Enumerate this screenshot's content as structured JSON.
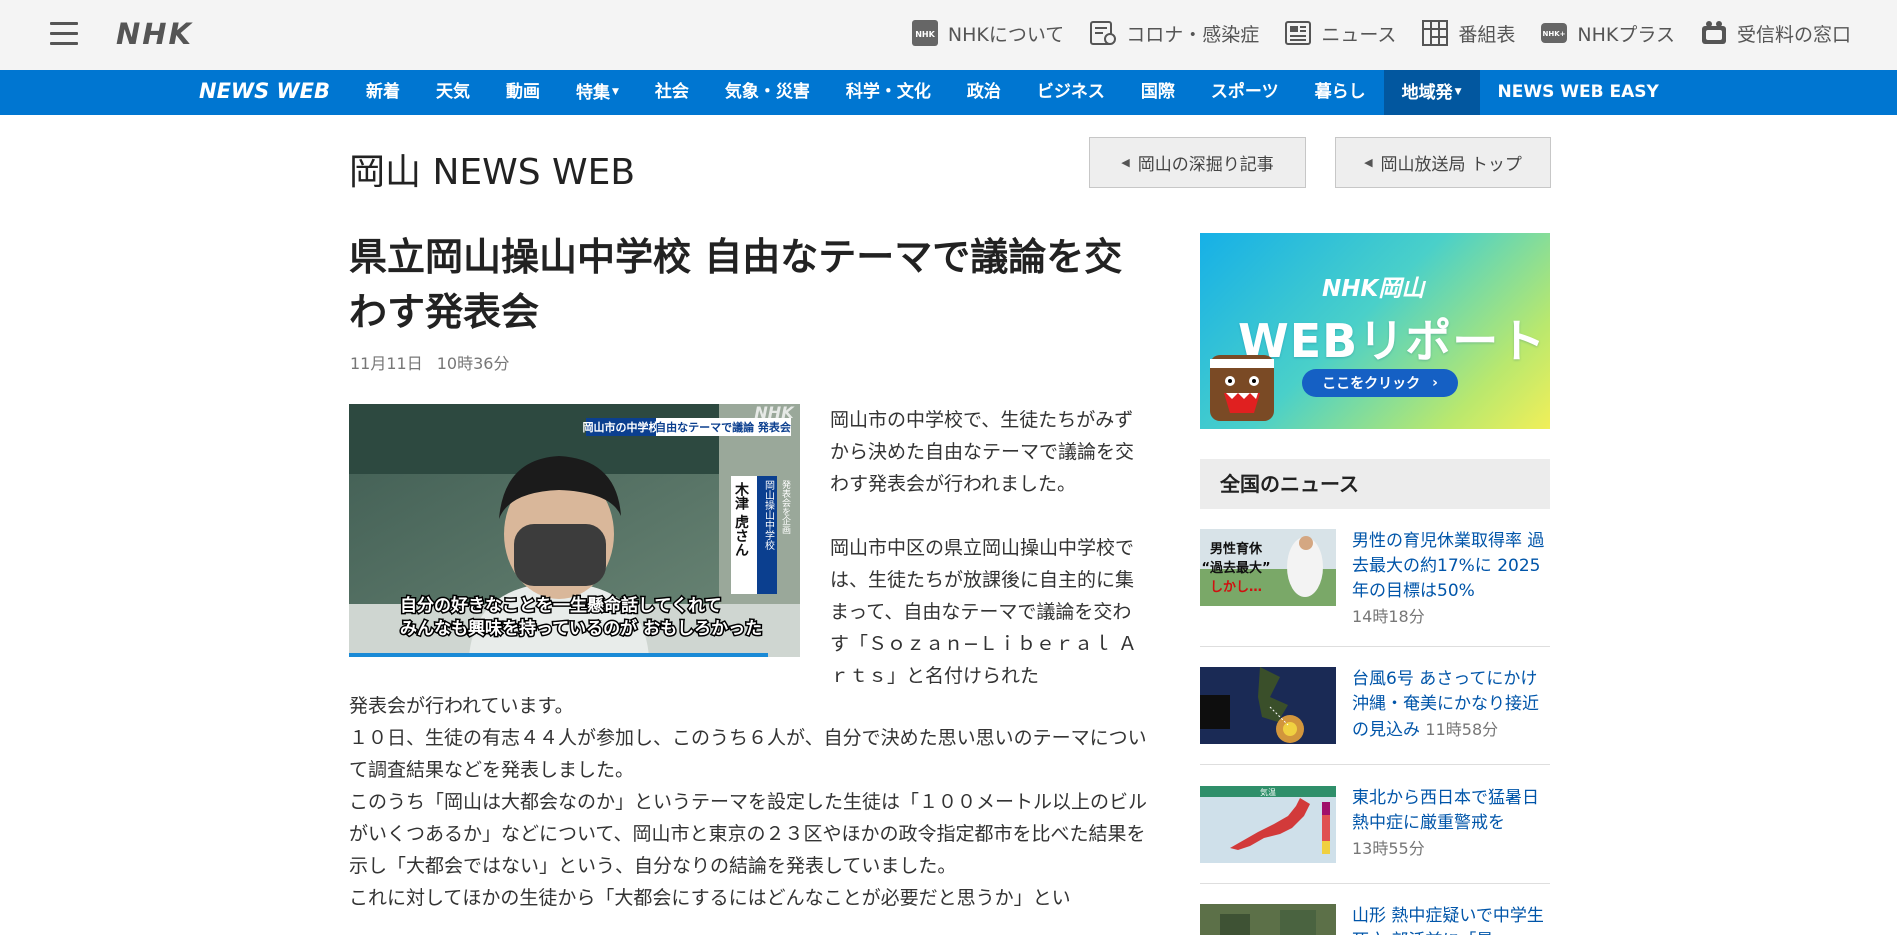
{
  "header": {
    "logo": "NHK",
    "links": [
      {
        "label": "NHKについて",
        "icon": "nhk-logo-icon"
      },
      {
        "label": "コロナ・感染症",
        "icon": "corona-info-icon"
      },
      {
        "label": "ニュース",
        "icon": "news-icon"
      },
      {
        "label": "番組表",
        "icon": "program-guide-icon"
      },
      {
        "label": "NHKプラス",
        "icon": "nhk-plus-icon"
      },
      {
        "label": "受信料の窓口",
        "icon": "reception-fee-icon"
      }
    ]
  },
  "nav": {
    "logo": "NEWS WEB",
    "items": [
      {
        "label": "新着"
      },
      {
        "label": "天気"
      },
      {
        "label": "動画"
      },
      {
        "label": "特集",
        "dropdown": true
      },
      {
        "label": "社会"
      },
      {
        "label": "気象・災害"
      },
      {
        "label": "科学・文化"
      },
      {
        "label": "政治"
      },
      {
        "label": "ビジネス"
      },
      {
        "label": "国際"
      },
      {
        "label": "スポーツ"
      },
      {
        "label": "暮らし"
      },
      {
        "label": "地域発",
        "dropdown": true,
        "active": true
      },
      {
        "label": "NEWS WEB EASY"
      }
    ],
    "colors": {
      "bar": "#0076d1",
      "active": "#02579f"
    }
  },
  "page": {
    "title": "岡山 NEWS WEB",
    "buttons": {
      "deep_dive": "岡山の深掘り記事",
      "station_top": "岡山放送局 トップ"
    }
  },
  "article": {
    "headline": "県立岡山操山中学校 自由なテーマで議論を交わす発表会",
    "date": "11月11日",
    "time": "10時36分",
    "photo": {
      "logo": "NHK",
      "caption_location": "岡山市の中学校",
      "caption_topic": "自由なテーマで議論 発表会",
      "name_role": "発表会を企画",
      "name_school": "岡山操山中学校",
      "name_person": "木津 虎さん",
      "subtitle_line1": "自分の好きなことを一生懸命話してくれて",
      "subtitle_line2": "みんなも興味を持っているのが おもしろかった",
      "video_progress": 0.93
    },
    "lead": [
      "岡山市の中学校で、生徒たちがみずから決めた自由なテーマで議論を交わす発表会が行われました。",
      "岡山市中区の県立岡山操山中学校では、生徒たちが放課後に自主的に集まって、自由なテーマで議論を交わす「Ｓｏｚａｎ−Ｌｉｂｅｒａｌ Ａｒｔｓ」と名付けられた"
    ],
    "body": [
      "発表会が行われています。",
      "１０日、生徒の有志４４人が参加し、このうち６人が、自分で決めた思い思いのテーマについて調査結果などを発表しました。",
      "このうち「岡山は大都会なのか」というテーマを設定した生徒は「１００メートル以上のビルがいくつあるか」などについて、岡山市と東京の２３区やほかの政令指定都市を比べた結果を示し「大都会ではない」という、自分なりの結論を発表していました。",
      "これに対してほかの生徒から「大都会にするにはどんなことが必要だと思うか」とい"
    ]
  },
  "sidebar": {
    "banner": {
      "brand": "NHK岡山",
      "title": "WEBリポート",
      "button": "ここをクリック"
    },
    "heading": "全国のニュース",
    "news": [
      {
        "title": "男性の育児休業取得率 過去最大の約17%に 2025年の目標は50%",
        "time": "14時18分",
        "thumb_line1": "男性育休",
        "thumb_line2": "“過去最大”",
        "thumb_line3": "しかし…"
      },
      {
        "title": "台風6号 あさってにかけ沖縄・奄美にかなり接近の見込み",
        "time": "11時58分"
      },
      {
        "title": "東北から西日本で猛暑日 熱中症に厳重警戒を",
        "time": "13時55分",
        "thumb_label": "気温"
      },
      {
        "title": "山形 熱中症疑いで中学生死亡 部活前に「暑",
        "time": ""
      }
    ]
  }
}
